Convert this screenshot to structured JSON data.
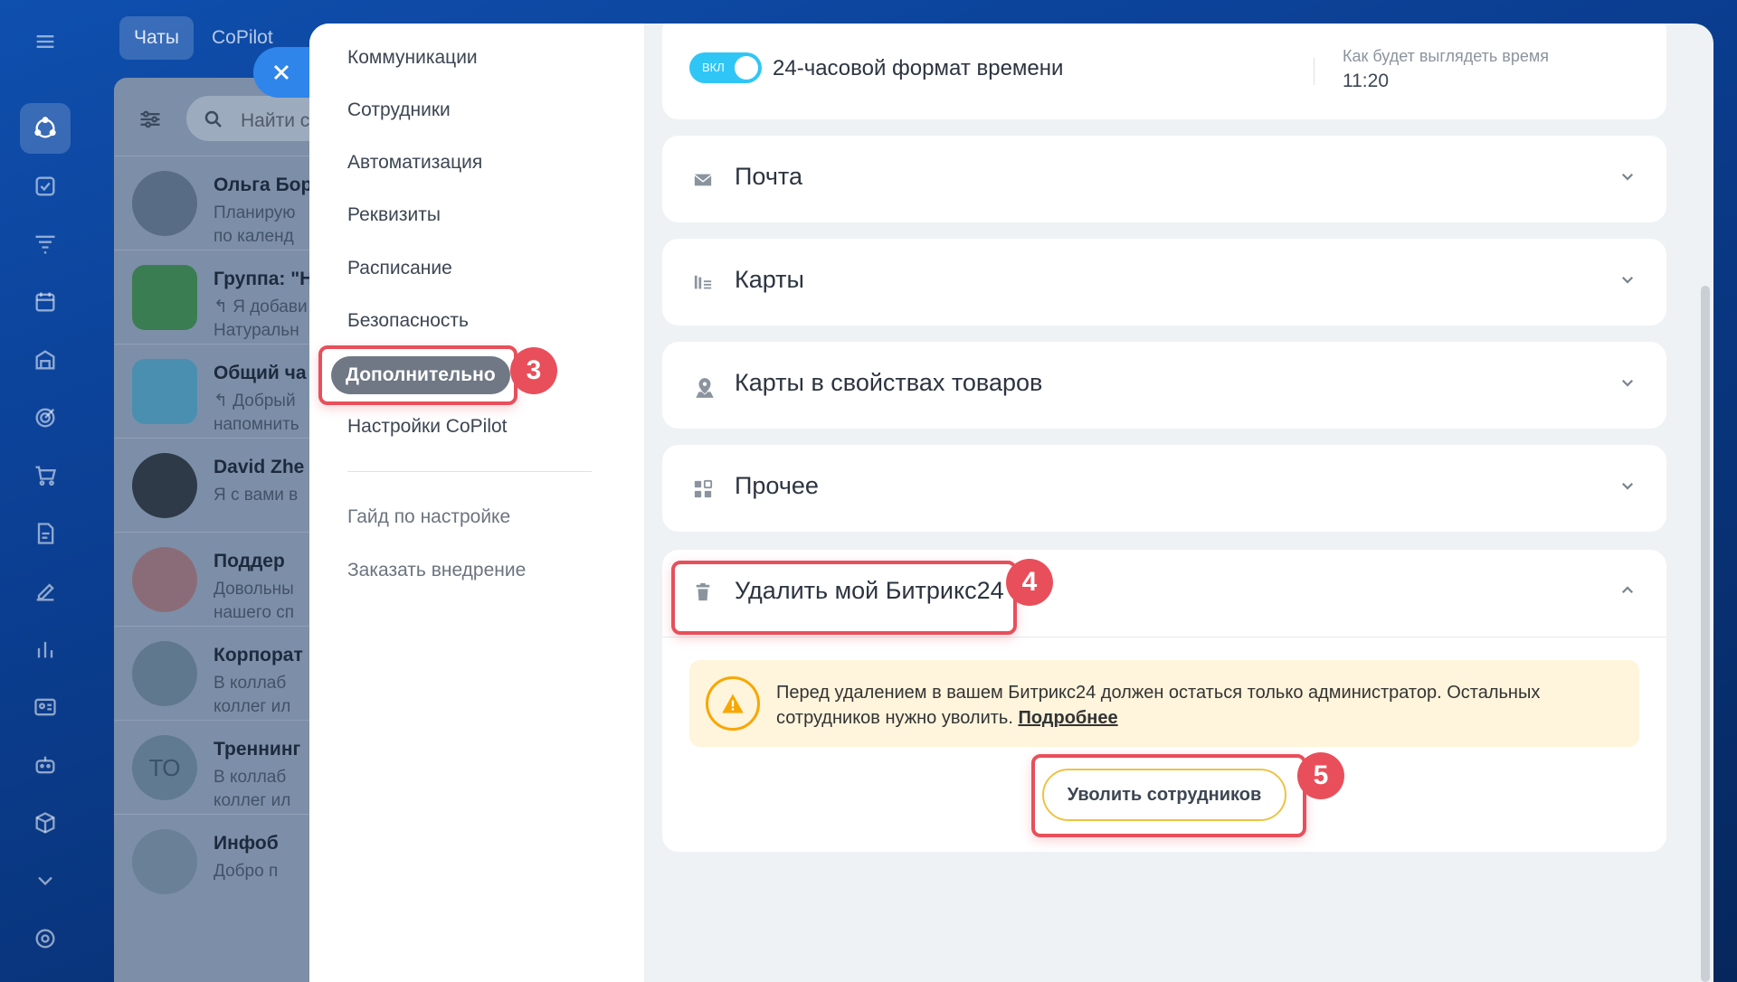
{
  "top_tabs": [
    "Чаты",
    "CoPilot"
  ],
  "chat_search_placeholder": "Найти с",
  "chats": [
    {
      "name": "Ольга Бор",
      "preview1": "Планирую",
      "preview2": "по календ"
    },
    {
      "name": "Группа: \"Н",
      "preview1": "↰ Я добави",
      "preview2": "Натуральн"
    },
    {
      "name": "Общий ча",
      "preview1": "↰ Добрый",
      "preview2": "напомнить"
    },
    {
      "name": "David Zhe",
      "preview1": "Я с вами в",
      "preview2": ""
    },
    {
      "name": "Поддер",
      "preview1": "Довольны",
      "preview2": "нашего сп"
    },
    {
      "name": "Корпорат",
      "preview1": "В коллаб",
      "preview2": "коллег ил"
    },
    {
      "name": "Треннинг",
      "preview1": "В коллаб",
      "preview2": "коллег ил"
    },
    {
      "name": "Инфоб",
      "preview1": "Добро п",
      "preview2": ""
    }
  ],
  "chat_avatar_initials": "ТО",
  "settings_menu": {
    "items": [
      "Коммуникации",
      "Сотрудники",
      "Автоматизация",
      "Реквизиты",
      "Расписание",
      "Безопасность",
      "Дополнительно",
      "Настройки CoPilot"
    ],
    "links": [
      "Гайд по настройке",
      "Заказать внедрение"
    ]
  },
  "time_format": {
    "toggle_label": "ВКЛ",
    "label": "24-часовой формат времени",
    "hint": "Как будет выглядеть время",
    "value": "11:20"
  },
  "sections": [
    "Почта",
    "Карты",
    "Карты в свойствах товаров",
    "Прочее"
  ],
  "delete_section": {
    "title": "Удалить мой Битрикс24",
    "warning": "Перед удалением в вашем Битрикс24 должен остаться только администратор. Остальных сотрудников нужно уволить.",
    "link": "Подробнее",
    "button": "Уволить сотрудников"
  },
  "badges": [
    "3",
    "4",
    "5"
  ],
  "colors": {
    "accent": "#2fc6f6",
    "highlight": "#e84f5b",
    "warning_bg": "#fff4dc",
    "warning_icon": "#f7a700"
  }
}
